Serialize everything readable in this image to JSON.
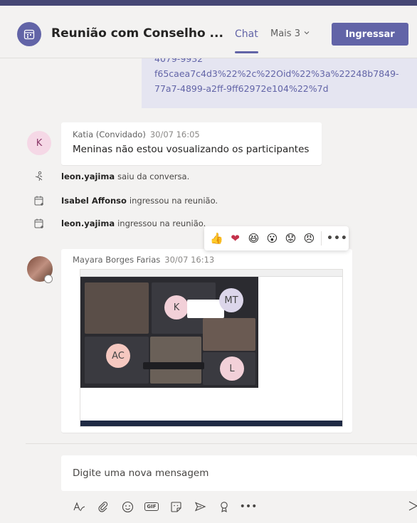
{
  "header": {
    "title": "Reunião com Conselho ...",
    "tab_chat": "Chat",
    "tab_more": "Mais 3",
    "join_label": "Ingressar"
  },
  "colors": {
    "brand": "#6264a7",
    "topbar": "#464775",
    "link_bubble": "#e5e5f1"
  },
  "link_message": {
    "cut_line": "4079-9932",
    "lines": [
      "f65caea7c4d3%22%2c%22Oid%22%3a%22248b7849-",
      "77a7-4899-a2ff-9ff62972e104%22%7d"
    ]
  },
  "messages": [
    {
      "initial": "K",
      "author": "Katia (Convidado)",
      "time": "30/07 16:05",
      "text": "Meninas não estou vosualizando os participantes"
    },
    {
      "author": "Mayara Borges Farias",
      "time": "30/07 16:13"
    }
  ],
  "events": [
    {
      "icon": "person-leave-icon",
      "user": "leon.yajima",
      "text": "saiu da conversa."
    },
    {
      "icon": "calendar-join-icon",
      "user": "Isabel Affonso",
      "text": "ingressou na reunião."
    },
    {
      "icon": "calendar-join-icon",
      "user": "leon.yajima",
      "text": "ingressou na reunião."
    }
  ],
  "reactions": [
    "👍",
    "❤",
    "😆",
    "😮",
    "😟",
    "😠"
  ],
  "shared_screenshot": {
    "participants": [
      "K",
      "MT",
      "AC",
      "L"
    ]
  },
  "compose": {
    "placeholder": "Digite uma nova mensagem",
    "tools": [
      "format-icon",
      "attach-icon",
      "emoji-icon",
      "gif-icon",
      "sticker-icon",
      "meet-now-icon",
      "praise-icon",
      "more-options-icon"
    ]
  }
}
